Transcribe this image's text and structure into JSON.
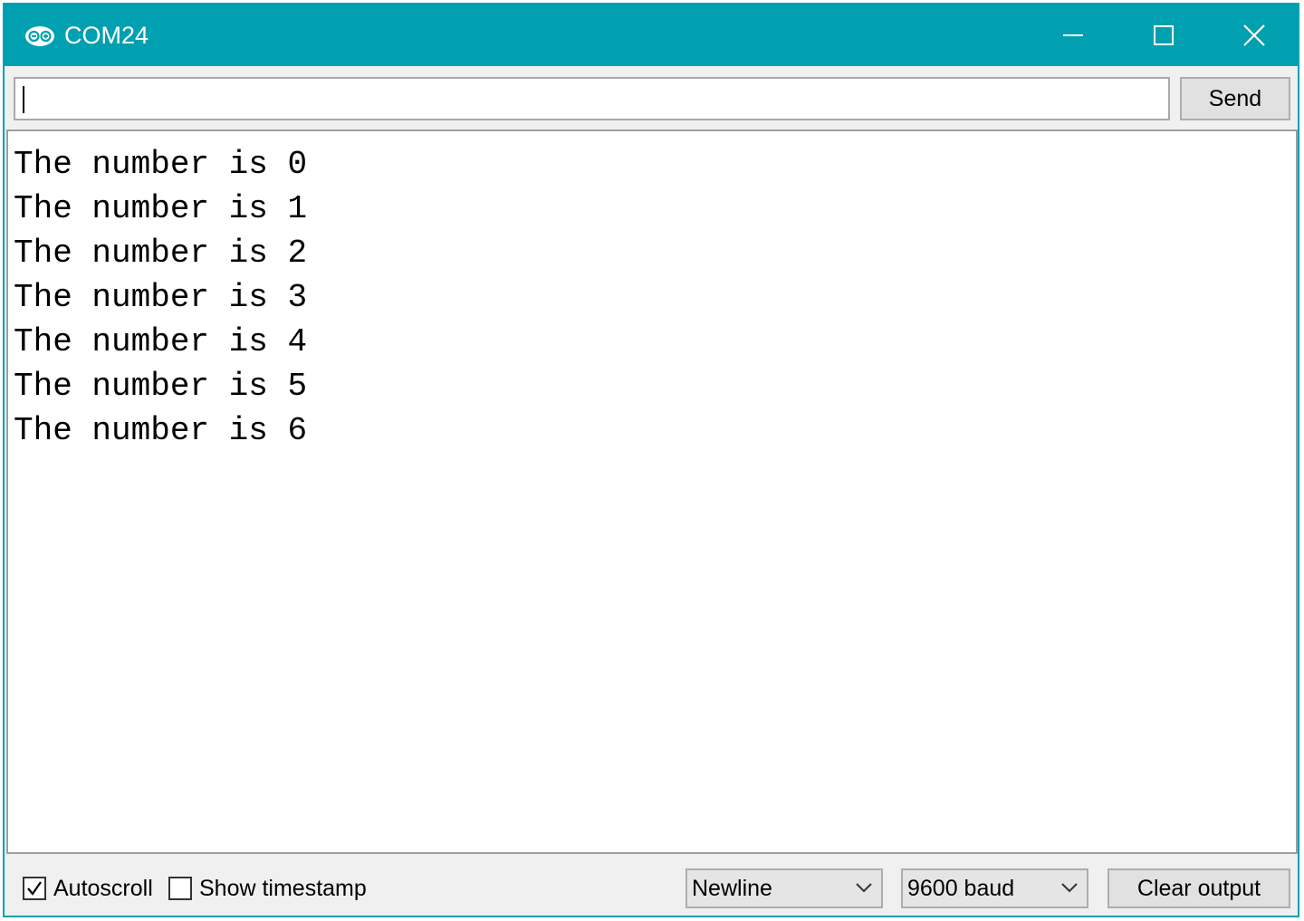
{
  "window": {
    "title": "COM24",
    "icon": "arduino-logo-icon",
    "controls": [
      "minimize-icon",
      "maximize-icon",
      "close-icon"
    ],
    "accent_color": "#00a0b0"
  },
  "input": {
    "value": "",
    "send_label": "Send"
  },
  "output": {
    "lines": [
      "The number is 0",
      "The number is 1",
      "The number is 2",
      "The number is 3",
      "The number is 4",
      "The number is 5",
      "The number is 6"
    ]
  },
  "statusbar": {
    "autoscroll": {
      "label": "Autoscroll",
      "checked": true
    },
    "timestamp": {
      "label": "Show timestamp",
      "checked": false
    },
    "line_ending": {
      "selected": "Newline"
    },
    "baud_rate": {
      "selected": "9600 baud"
    },
    "clear_label": "Clear output"
  }
}
